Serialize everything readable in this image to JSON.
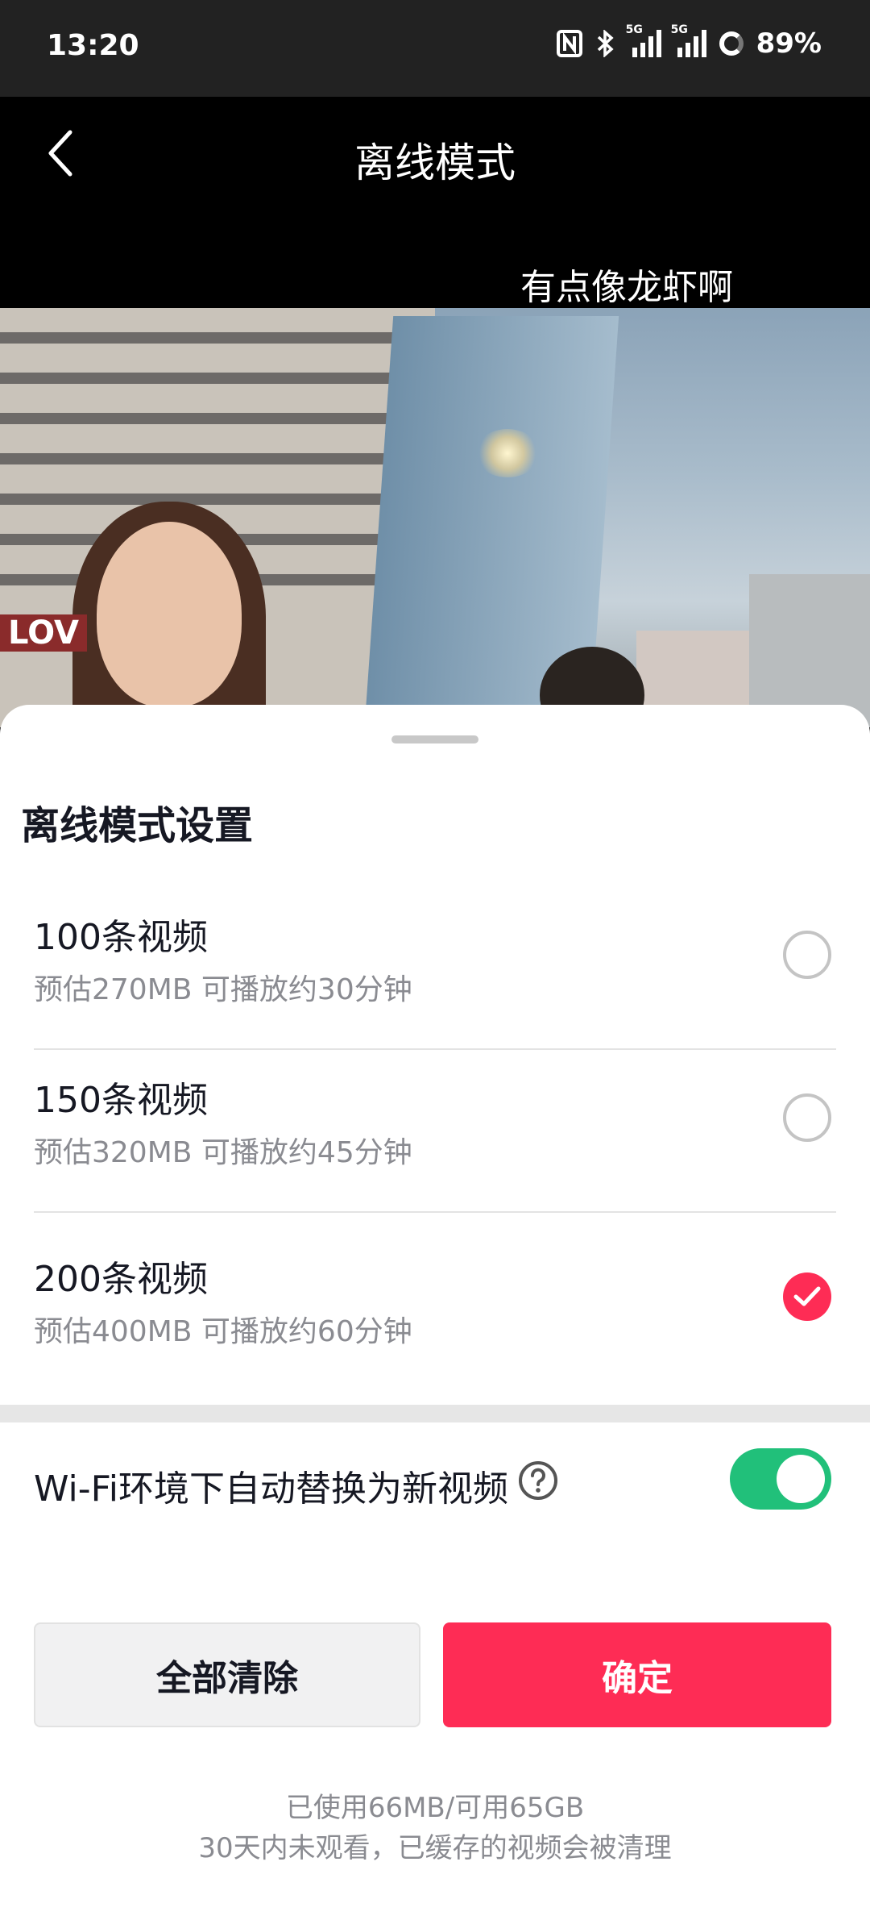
{
  "status_bar": {
    "time": "13:20",
    "battery": "89%",
    "signal_tag": "5G",
    "icons": [
      "nfc-icon",
      "bluetooth-icon",
      "signal-5g-icon",
      "signal-5g-icon",
      "battery-icon"
    ]
  },
  "header": {
    "title": "离线模式",
    "back_icon": "chevron-left-icon"
  },
  "video": {
    "caption": "有点像龙虾啊",
    "sign_text": "LOV"
  },
  "sheet": {
    "title": "离线模式设置",
    "options": [
      {
        "title": "100条视频",
        "subtitle": "预估270MB 可播放约30分钟",
        "selected": false
      },
      {
        "title": "150条视频",
        "subtitle": "预估320MB 可播放约45分钟",
        "selected": false
      },
      {
        "title": "200条视频",
        "subtitle": "预估400MB 可播放约60分钟",
        "selected": true
      }
    ],
    "wifi_setting": {
      "label": "Wi-Fi环境下自动替换为新视频",
      "enabled": true,
      "help_icon": "question-icon"
    },
    "buttons": {
      "clear_all": "全部清除",
      "confirm": "确定"
    },
    "footer": {
      "storage": "已使用66MB/可用65GB",
      "note": "30天内未观看，已缓存的视频会被清理"
    }
  },
  "colors": {
    "accent": "#fe2c55",
    "toggle_on": "#21c07a",
    "secondary_text": "#8a8b91"
  }
}
